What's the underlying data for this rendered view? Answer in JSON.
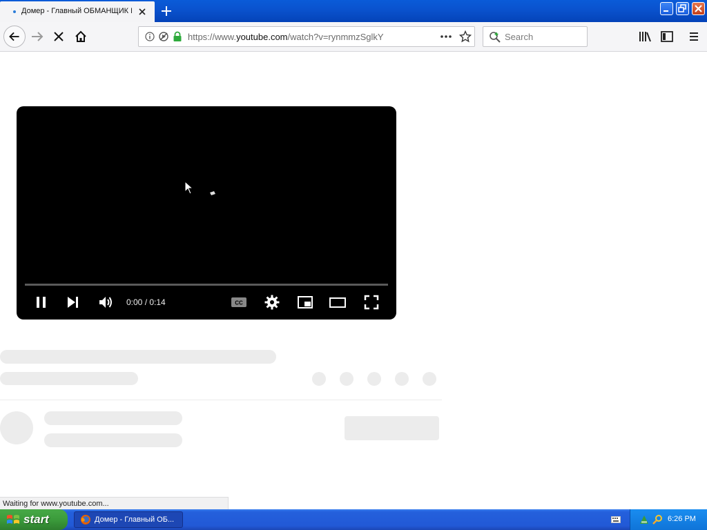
{
  "browser": {
    "tab": {
      "title": "Домер - Главный ОБМАНЩИК И"
    },
    "url": {
      "prefix": "https://www.",
      "host": "youtube.com",
      "path": "/watch?v=rynmmzSglkY"
    },
    "search": {
      "placeholder": "Search"
    },
    "status": "Waiting for www.youtube.com..."
  },
  "player": {
    "time": "0:00 / 0:14",
    "progress": 0
  },
  "taskbar": {
    "start_label": "start",
    "task_label": "Домер - Главный ОБ...",
    "clock": "6:26 PM"
  },
  "icons": {
    "back": "back-arrow-icon",
    "forward": "forward-arrow-icon",
    "stop": "stop-icon",
    "home": "home-icon",
    "library": "library-icon",
    "sidebar": "sidebar-icon",
    "menu": "hamburger-menu-icon"
  },
  "colors": {
    "xp_blue": "#0a53cf",
    "start_green": "#3b9b3b",
    "secure_lock": "#2eaa3c",
    "skeleton": "#ececec"
  }
}
